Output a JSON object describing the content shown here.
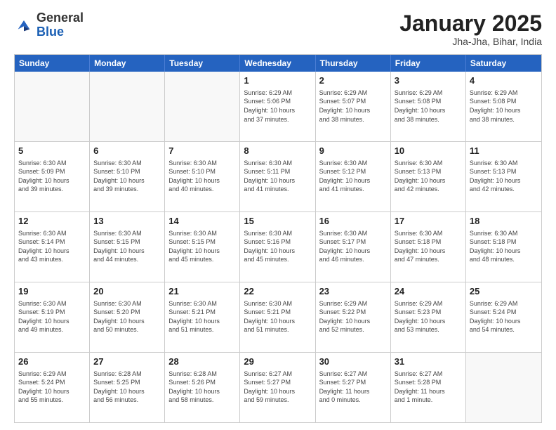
{
  "logo": {
    "general": "General",
    "blue": "Blue"
  },
  "title": "January 2025",
  "subtitle": "Jha-Jha, Bihar, India",
  "weekdays": [
    "Sunday",
    "Monday",
    "Tuesday",
    "Wednesday",
    "Thursday",
    "Friday",
    "Saturday"
  ],
  "rows": [
    [
      {
        "day": "",
        "info": ""
      },
      {
        "day": "",
        "info": ""
      },
      {
        "day": "",
        "info": ""
      },
      {
        "day": "1",
        "info": "Sunrise: 6:29 AM\nSunset: 5:06 PM\nDaylight: 10 hours\nand 37 minutes."
      },
      {
        "day": "2",
        "info": "Sunrise: 6:29 AM\nSunset: 5:07 PM\nDaylight: 10 hours\nand 38 minutes."
      },
      {
        "day": "3",
        "info": "Sunrise: 6:29 AM\nSunset: 5:08 PM\nDaylight: 10 hours\nand 38 minutes."
      },
      {
        "day": "4",
        "info": "Sunrise: 6:29 AM\nSunset: 5:08 PM\nDaylight: 10 hours\nand 38 minutes."
      }
    ],
    [
      {
        "day": "5",
        "info": "Sunrise: 6:30 AM\nSunset: 5:09 PM\nDaylight: 10 hours\nand 39 minutes."
      },
      {
        "day": "6",
        "info": "Sunrise: 6:30 AM\nSunset: 5:10 PM\nDaylight: 10 hours\nand 39 minutes."
      },
      {
        "day": "7",
        "info": "Sunrise: 6:30 AM\nSunset: 5:10 PM\nDaylight: 10 hours\nand 40 minutes."
      },
      {
        "day": "8",
        "info": "Sunrise: 6:30 AM\nSunset: 5:11 PM\nDaylight: 10 hours\nand 41 minutes."
      },
      {
        "day": "9",
        "info": "Sunrise: 6:30 AM\nSunset: 5:12 PM\nDaylight: 10 hours\nand 41 minutes."
      },
      {
        "day": "10",
        "info": "Sunrise: 6:30 AM\nSunset: 5:13 PM\nDaylight: 10 hours\nand 42 minutes."
      },
      {
        "day": "11",
        "info": "Sunrise: 6:30 AM\nSunset: 5:13 PM\nDaylight: 10 hours\nand 42 minutes."
      }
    ],
    [
      {
        "day": "12",
        "info": "Sunrise: 6:30 AM\nSunset: 5:14 PM\nDaylight: 10 hours\nand 43 minutes."
      },
      {
        "day": "13",
        "info": "Sunrise: 6:30 AM\nSunset: 5:15 PM\nDaylight: 10 hours\nand 44 minutes."
      },
      {
        "day": "14",
        "info": "Sunrise: 6:30 AM\nSunset: 5:15 PM\nDaylight: 10 hours\nand 45 minutes."
      },
      {
        "day": "15",
        "info": "Sunrise: 6:30 AM\nSunset: 5:16 PM\nDaylight: 10 hours\nand 45 minutes."
      },
      {
        "day": "16",
        "info": "Sunrise: 6:30 AM\nSunset: 5:17 PM\nDaylight: 10 hours\nand 46 minutes."
      },
      {
        "day": "17",
        "info": "Sunrise: 6:30 AM\nSunset: 5:18 PM\nDaylight: 10 hours\nand 47 minutes."
      },
      {
        "day": "18",
        "info": "Sunrise: 6:30 AM\nSunset: 5:18 PM\nDaylight: 10 hours\nand 48 minutes."
      }
    ],
    [
      {
        "day": "19",
        "info": "Sunrise: 6:30 AM\nSunset: 5:19 PM\nDaylight: 10 hours\nand 49 minutes."
      },
      {
        "day": "20",
        "info": "Sunrise: 6:30 AM\nSunset: 5:20 PM\nDaylight: 10 hours\nand 50 minutes."
      },
      {
        "day": "21",
        "info": "Sunrise: 6:30 AM\nSunset: 5:21 PM\nDaylight: 10 hours\nand 51 minutes."
      },
      {
        "day": "22",
        "info": "Sunrise: 6:30 AM\nSunset: 5:21 PM\nDaylight: 10 hours\nand 51 minutes."
      },
      {
        "day": "23",
        "info": "Sunrise: 6:29 AM\nSunset: 5:22 PM\nDaylight: 10 hours\nand 52 minutes."
      },
      {
        "day": "24",
        "info": "Sunrise: 6:29 AM\nSunset: 5:23 PM\nDaylight: 10 hours\nand 53 minutes."
      },
      {
        "day": "25",
        "info": "Sunrise: 6:29 AM\nSunset: 5:24 PM\nDaylight: 10 hours\nand 54 minutes."
      }
    ],
    [
      {
        "day": "26",
        "info": "Sunrise: 6:29 AM\nSunset: 5:24 PM\nDaylight: 10 hours\nand 55 minutes."
      },
      {
        "day": "27",
        "info": "Sunrise: 6:28 AM\nSunset: 5:25 PM\nDaylight: 10 hours\nand 56 minutes."
      },
      {
        "day": "28",
        "info": "Sunrise: 6:28 AM\nSunset: 5:26 PM\nDaylight: 10 hours\nand 58 minutes."
      },
      {
        "day": "29",
        "info": "Sunrise: 6:27 AM\nSunset: 5:27 PM\nDaylight: 10 hours\nand 59 minutes."
      },
      {
        "day": "30",
        "info": "Sunrise: 6:27 AM\nSunset: 5:27 PM\nDaylight: 11 hours\nand 0 minutes."
      },
      {
        "day": "31",
        "info": "Sunrise: 6:27 AM\nSunset: 5:28 PM\nDaylight: 11 hours\nand 1 minute."
      },
      {
        "day": "",
        "info": ""
      }
    ]
  ]
}
